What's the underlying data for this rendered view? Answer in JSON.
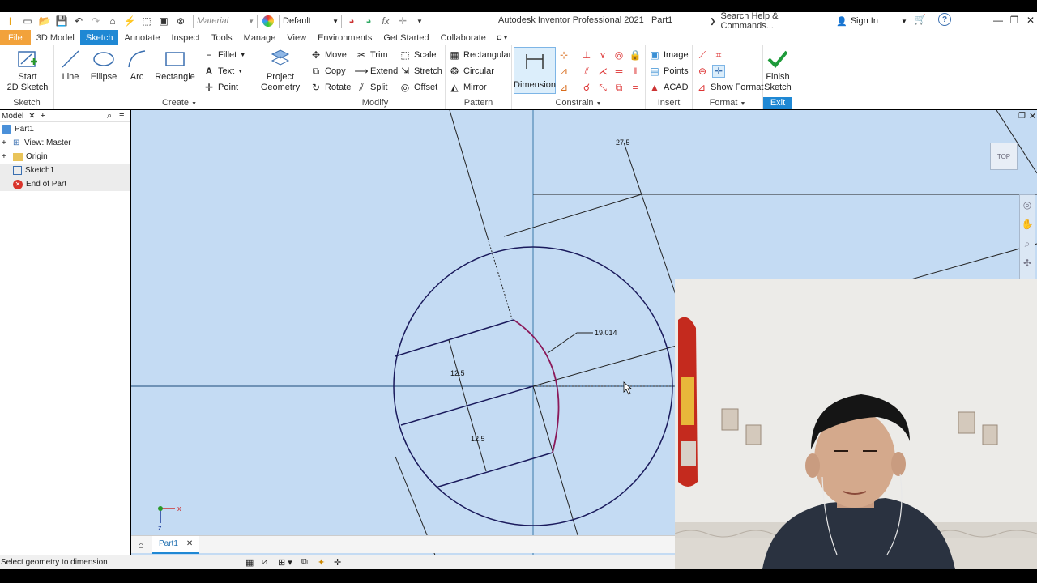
{
  "titlebar": {
    "material_placeholder": "Material",
    "appearance_value": "Default",
    "app_title": "Autodesk Inventor Professional 2021",
    "doc_name": "Part1",
    "search_placeholder": "Search Help & Commands...",
    "signin_label": "Sign In"
  },
  "tabs": [
    "File",
    "3D Model",
    "Sketch",
    "Annotate",
    "Inspect",
    "Tools",
    "Manage",
    "View",
    "Environments",
    "Get Started",
    "Collaborate"
  ],
  "ribbon": {
    "sketch_panel": {
      "title": "Sketch",
      "start_label_1": "Start",
      "start_label_2": "2D Sketch"
    },
    "create_panel": {
      "title": "Create",
      "line": "Line",
      "ellipse": "Ellipse",
      "arc": "Arc",
      "rectangle": "Rectangle",
      "fillet": "Fillet",
      "text": "Text",
      "point": "Point",
      "project_1": "Project",
      "project_2": "Geometry"
    },
    "modify_panel": {
      "title": "Modify",
      "move": "Move",
      "copy": "Copy",
      "rotate": "Rotate",
      "trim": "Trim",
      "extend": "Extend",
      "split": "Split",
      "scale": "Scale",
      "stretch": "Stretch",
      "offset": "Offset"
    },
    "pattern_panel": {
      "title": "Pattern",
      "rectangular": "Rectangular",
      "circular": "Circular",
      "mirror": "Mirror"
    },
    "constrain_panel": {
      "title": "Constrain",
      "dimension": "Dimension"
    },
    "insert_panel": {
      "title": "Insert",
      "image": "Image",
      "points": "Points",
      "acad": "ACAD"
    },
    "format_panel": {
      "title": "Format",
      "show_format": "Show Format"
    },
    "exit_panel": {
      "title": "Exit",
      "finish_1": "Finish",
      "finish_2": "Sketch"
    }
  },
  "browser": {
    "tab_label": "Model",
    "items": [
      {
        "label": "Part1",
        "icon": "part-icon"
      },
      {
        "label": "View: Master",
        "icon": "view-icon"
      },
      {
        "label": "Origin",
        "icon": "folder-icon"
      },
      {
        "label": "Sketch1",
        "icon": "sketch-icon"
      },
      {
        "label": "End of Part",
        "icon": "end-of-part-icon"
      }
    ]
  },
  "canvas": {
    "view_cube_label": "TOP",
    "dimensions": {
      "top": "27.5",
      "arc": "19.014",
      "upper": "12.5",
      "lower": "12.5"
    },
    "triad": {
      "x": "x",
      "z": "z"
    }
  },
  "doc_tab": {
    "label": "Part1"
  },
  "status": {
    "text": "Select geometry to dimension"
  },
  "colors": {
    "file_tab": "#f2a23b",
    "active_tab": "#1f88d4",
    "canvas_bg": "#c4dbf3",
    "sketch_line": "#1a1a5c",
    "arc_line": "#8b1a5a"
  }
}
